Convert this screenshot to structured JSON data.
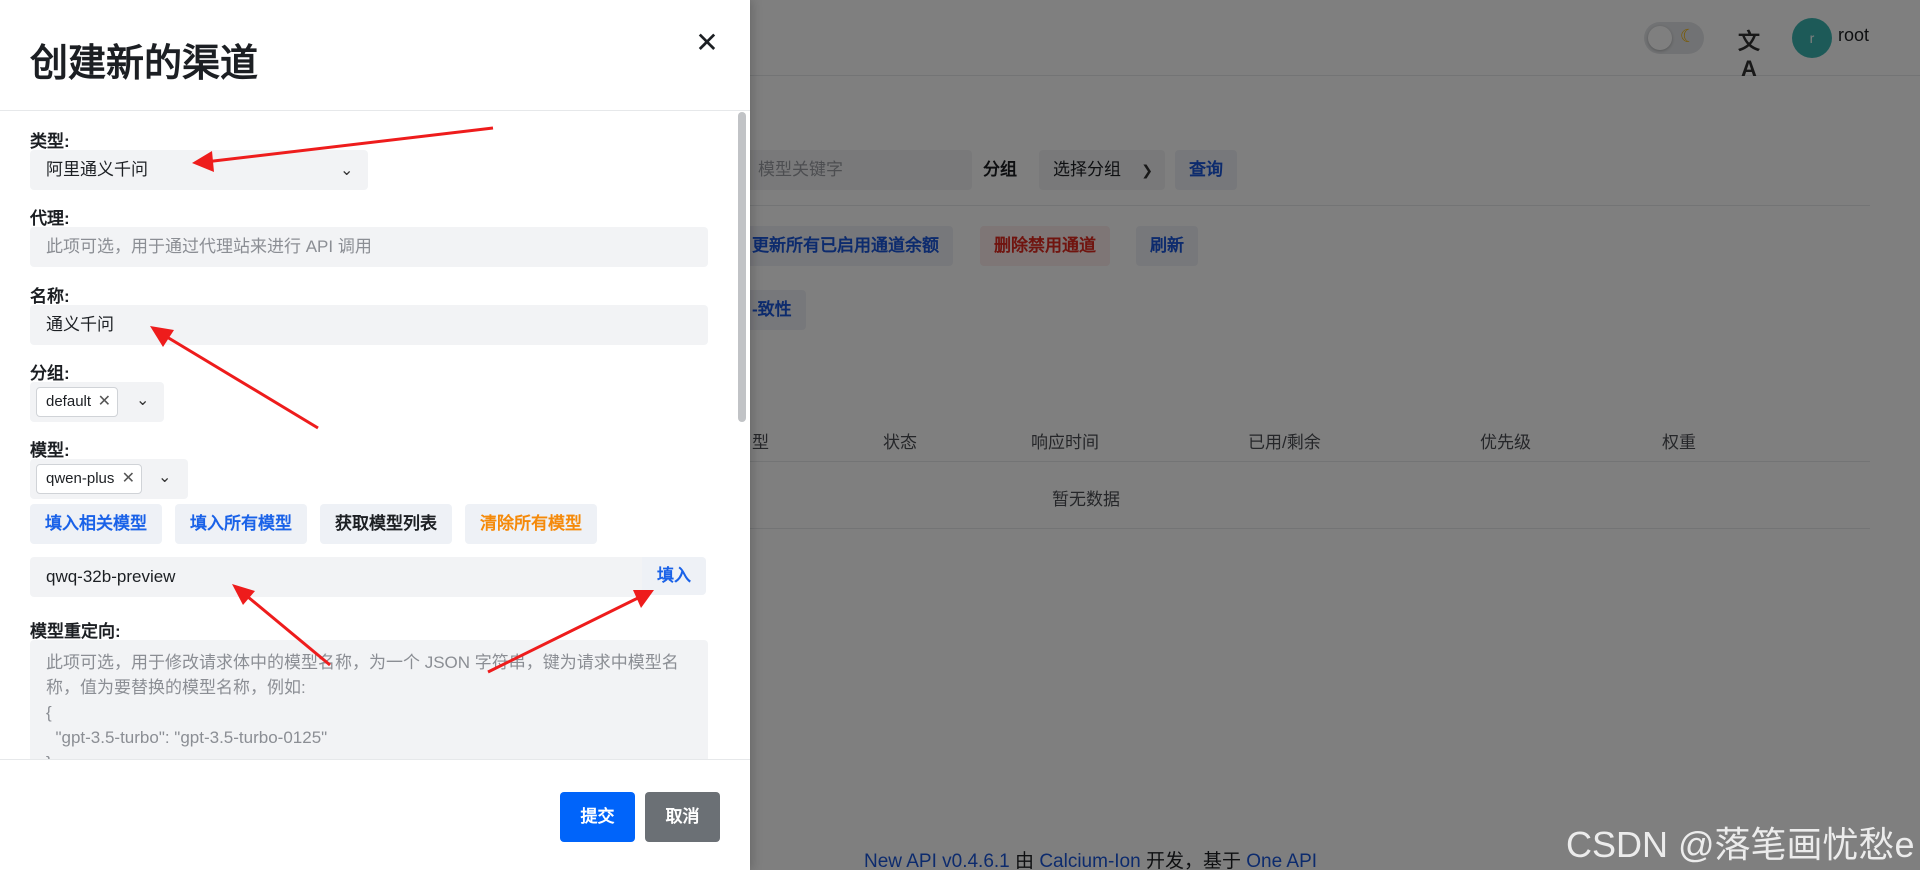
{
  "header": {
    "username": "root",
    "avatar_letter": "r",
    "lang_icon": "文A",
    "theme_icon": "☾"
  },
  "background": {
    "search_placeholder": "模型关键字",
    "group_label": "分组",
    "group_select": "选择分组",
    "query_button": "查询",
    "update_balance_button": "更新所有已启用通道余额",
    "delete_disabled_button": "删除禁用通道",
    "refresh_button": "刷新",
    "consistency_button": "-致性",
    "table_headers": [
      "型",
      "状态",
      "响应时间",
      "已用/剩余",
      "优先级",
      "权重"
    ],
    "empty_text": "暂无数据",
    "footer": {
      "version": "New API v0.4.6.1",
      "by": "由",
      "author": "Calcium-Ion",
      "dev": "开发，基于",
      "base": "One API"
    }
  },
  "modal": {
    "title": "创建新的渠道",
    "type_label": "类型:",
    "type_value": "阿里通义千问",
    "proxy_label": "代理:",
    "proxy_placeholder": "此项可选，用于通过代理站来进行 API 调用",
    "name_label": "名称:",
    "name_value": "通义千问",
    "group_label": "分组:",
    "group_tags": [
      "default"
    ],
    "model_label": "模型:",
    "model_tags": [
      "qwen-plus"
    ],
    "buttons": {
      "fill_related": "填入相关模型",
      "fill_all": "填入所有模型",
      "fetch_list": "获取模型列表",
      "clear_all": "清除所有模型"
    },
    "custom_model_value": "qwq-32b-preview",
    "fill_button": "填入",
    "redirect_label": "模型重定向:",
    "redirect_placeholder": "此项可选，用于修改请求体中的模型名称，为一个 JSON 字符串，键为请求中模型名称，值为要替换的模型名称，例如:\n{\n  \"gpt-3.5-turbo\": \"gpt-3.5-turbo-0125\"\n}",
    "submit": "提交",
    "cancel": "取消"
  },
  "watermark": "CSDN @落笔画忧愁e",
  "colors": {
    "primary": "#0064fa",
    "link_blue": "#1a62e8",
    "orange": "#f58a0a",
    "danger": "#e0281e",
    "annotation_arrow": "#ee1c1c"
  }
}
